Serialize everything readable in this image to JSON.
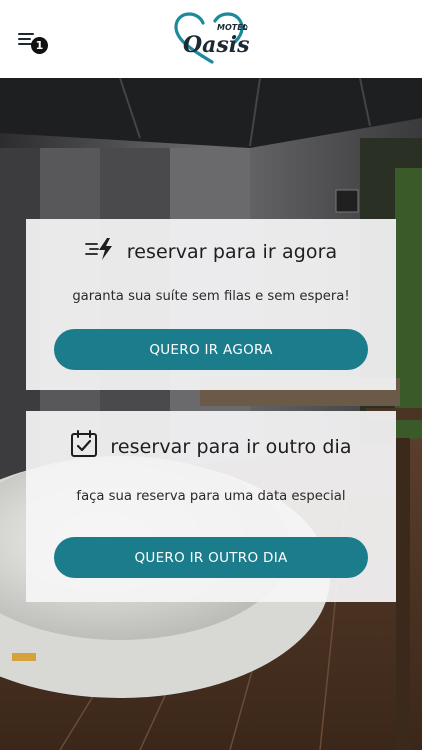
{
  "header": {
    "menu_icon": "hamburger-menu-icon",
    "menu_badge_count": "1",
    "logo": {
      "small_text": "MOTEL",
      "main_text": "Oasis",
      "icon": "heart-logo-icon",
      "accent_color": "#1b8a9a"
    }
  },
  "cards": {
    "now": {
      "icon": "fast-lightning-icon",
      "title": "reservar para ir agora",
      "subtitle": "garanta sua suíte sem filas e sem espera!",
      "button_label": "QUERO IR AGORA"
    },
    "other_day": {
      "icon": "calendar-check-icon",
      "title": "reservar para ir outro dia",
      "subtitle": "faça sua reserva para uma data especial",
      "button_label": "QUERO IR OUTRO DIA"
    }
  },
  "colors": {
    "button": "#1b7d8c",
    "card_bg": "#f5f5f6",
    "text": "#1e1e1e"
  }
}
